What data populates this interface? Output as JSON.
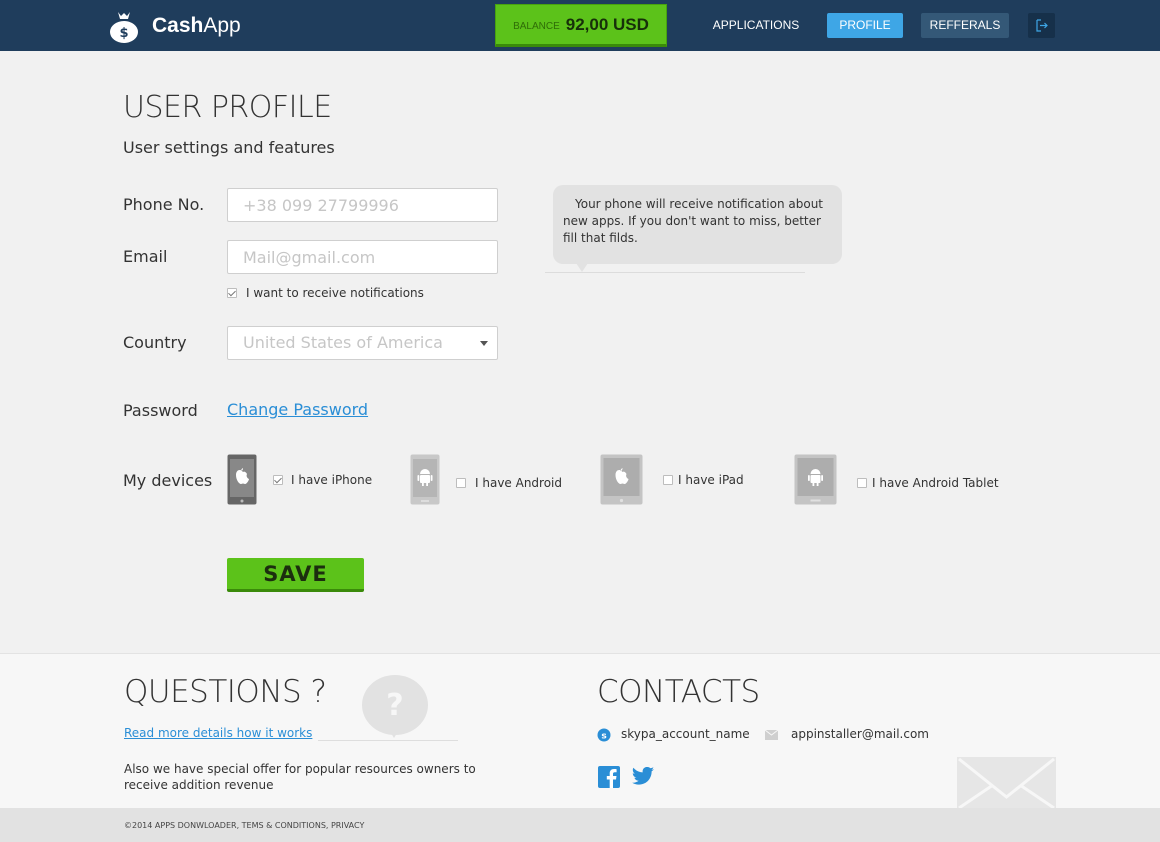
{
  "header": {
    "logo_bold": "Cash",
    "logo_regular": "App",
    "balance_label": "BALANCE",
    "balance_value": "92,00 USD",
    "nav": {
      "applications": "APPLICATIONS",
      "profile": "PROFILE",
      "referrals": "REFFERALS"
    },
    "logout_icon": "logout-icon"
  },
  "main": {
    "title": "USER PROFILE",
    "subtitle": "User settings and features",
    "phone": {
      "label": "Phone No.",
      "placeholder": "+38 099 27799996"
    },
    "email": {
      "label": "Email",
      "placeholder": "Mail@gmail.com"
    },
    "notifications": {
      "label": "I want to receive notifications",
      "checked": true
    },
    "tooltip": "Your phone will receive notification about new apps. If you don't want to miss, better fill that filds.",
    "country": {
      "label": "Country",
      "selected": "United States of America"
    },
    "password": {
      "label": "Password",
      "link": "Change Password"
    },
    "devices": {
      "label": "My devices",
      "items": [
        {
          "label": "I have iPhone",
          "checked": true,
          "icon": "apple-phone-icon"
        },
        {
          "label": "I have Android",
          "checked": false,
          "icon": "android-phone-icon"
        },
        {
          "label": "I have iPad",
          "checked": false,
          "icon": "apple-tablet-icon"
        },
        {
          "label": "I have Android Tablet",
          "checked": false,
          "icon": "android-tablet-icon"
        }
      ]
    },
    "save_label": "SAVE"
  },
  "footer": {
    "questions_title": "QUESTIONS ?",
    "questions_link": "Read more details how it works",
    "questions_text": "Also we have special offer for popular resources owners to receive addition revenue",
    "contacts_title": "CONTACTS",
    "skype": "skypa_account_name",
    "email": "appinstaller@mail.com",
    "copyright": "©2014 APPS DONWLOADER, TEMS & CONDITIONS, PRIVACY"
  },
  "colors": {
    "header_bg": "#1f3d5c",
    "balance_green": "#5cc21a",
    "profile_active": "#3ea6e6",
    "link_blue": "#2a8ed6"
  }
}
